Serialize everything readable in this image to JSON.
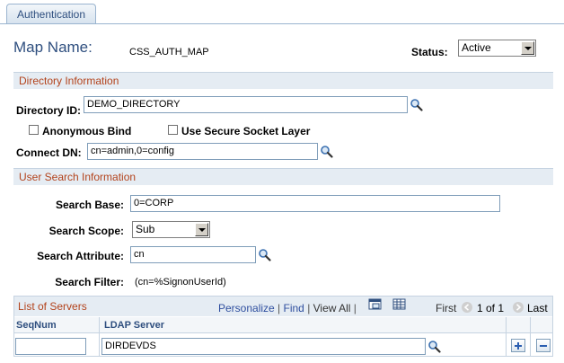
{
  "tab": {
    "label": "Authentication"
  },
  "header": {
    "map_name_label": "Map Name:",
    "map_name_value": "CSS_AUTH_MAP",
    "status_label": "Status:",
    "status_value": "Active"
  },
  "directory": {
    "section_title": "Directory Information",
    "directory_id_label": "Directory ID:",
    "directory_id_value": "DEMO_DIRECTORY",
    "anonymous_bind_label": "Anonymous Bind",
    "anonymous_bind_checked": false,
    "secure_socket_label": "Use Secure Socket Layer",
    "secure_socket_checked": false,
    "connect_dn_label": "Connect DN:",
    "connect_dn_value": "cn=admin,0=config"
  },
  "user_search": {
    "section_title": "User Search Information",
    "search_base_label": "Search Base:",
    "search_base_value": "0=CORP",
    "search_scope_label": "Search Scope:",
    "search_scope_value": "Sub",
    "search_attribute_label": "Search Attribute:",
    "search_attribute_value": "cn",
    "search_filter_label": "Search Filter:",
    "search_filter_value": "(cn=%SignonUserId)"
  },
  "servers_grid": {
    "title": "List of Servers",
    "personalize_label": "Personalize",
    "find_label": "Find",
    "view_all_label": "View All",
    "first_label": "First",
    "pager_text": "1 of 1",
    "last_label": "Last",
    "columns": [
      "SeqNum",
      "LDAP Server"
    ],
    "rows": [
      {
        "seqnum": "",
        "ldap_server": "DIRDEVDS"
      }
    ]
  },
  "colors": {
    "section_bg": "#e5ecf3",
    "section_text": "#b3431c",
    "link": "#2f4f9f",
    "heading_blue": "#2f4f7f"
  }
}
